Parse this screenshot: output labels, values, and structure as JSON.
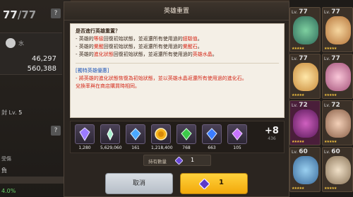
{
  "background": {
    "left": {
      "level_text": "77",
      "level_max": "/77",
      "element_label": "水",
      "stat_1": "46,297",
      "stat_2": "560,388",
      "help_label": "?",
      "sub_level_prefix": "封",
      "sub_level_label": "Lv.",
      "sub_level_value": "5",
      "favorite_label": "受傷",
      "neg_label": "負",
      "percent_label": "4.0%"
    },
    "roster": [
      {
        "lv": "77",
        "stars": "★★★★★"
      },
      {
        "lv": "77",
        "stars": "★★★★★"
      },
      {
        "lv": "77",
        "stars": "★★★★★"
      },
      {
        "lv": "77",
        "stars": "★★★★★"
      },
      {
        "lv": "72",
        "stars": "★★★★★"
      },
      {
        "lv": "72",
        "stars": "★★★★★"
      },
      {
        "lv": "60",
        "stars": "★★★★★"
      },
      {
        "lv": "60",
        "stars": "★★★★★"
      }
    ]
  },
  "dialog": {
    "title": "英雄重置",
    "question": "是否進行英雄重置？",
    "line1_pre": "- 英雄的",
    "line1_hl": "等級",
    "line1_mid": "回復初始狀態，並返還所有使用過的",
    "line1_hl2": "經驗值",
    "line1_end": "。",
    "line2_pre": "- 英雄的",
    "line2_hl": "覺醒",
    "line2_mid": "回復初始狀態，並返還所有使用過的",
    "line2_hl2": "覺醒石",
    "line2_end": "。",
    "line3_pre": "- 英雄的",
    "line3_hl": "進化狀態",
    "line3_mid": "回復初始狀態，並返還所有使用過的",
    "line3_hl2": "英雄水晶",
    "line3_end": "。",
    "special_title": "[獨特英雄優惠]",
    "special_line1": "- 將英雄的進化狀態恢復為初始狀態，並以英雄水晶返還所有使用過的進化石。",
    "special_line2": "兌換率與在商店購買時相同。",
    "items": [
      {
        "qty": "1,280",
        "icon": "purple-crystal-icon",
        "color": "#9b7bff"
      },
      {
        "qty": "5,629,060",
        "icon": "exp-crystal-icon",
        "color": "#a8f0d0"
      },
      {
        "qty": "161",
        "icon": "blue-gem-icon",
        "color": "#4aa8ff"
      },
      {
        "qty": "1,218,400",
        "icon": "gold-coin-icon",
        "color": "#f5b21b"
      },
      {
        "qty": "768",
        "icon": "green-gem-icon",
        "color": "#3cc84a"
      },
      {
        "qty": "663",
        "icon": "blue-crystal-icon",
        "color": "#3b7cff"
      },
      {
        "qty": "105",
        "icon": "violet-crystal-icon",
        "color": "#c874ff"
      }
    ],
    "more_label": "+8",
    "more_count": "436",
    "owned_label": "持有數量",
    "owned_value": "1",
    "cancel_label": "取消",
    "confirm_value": "1"
  }
}
